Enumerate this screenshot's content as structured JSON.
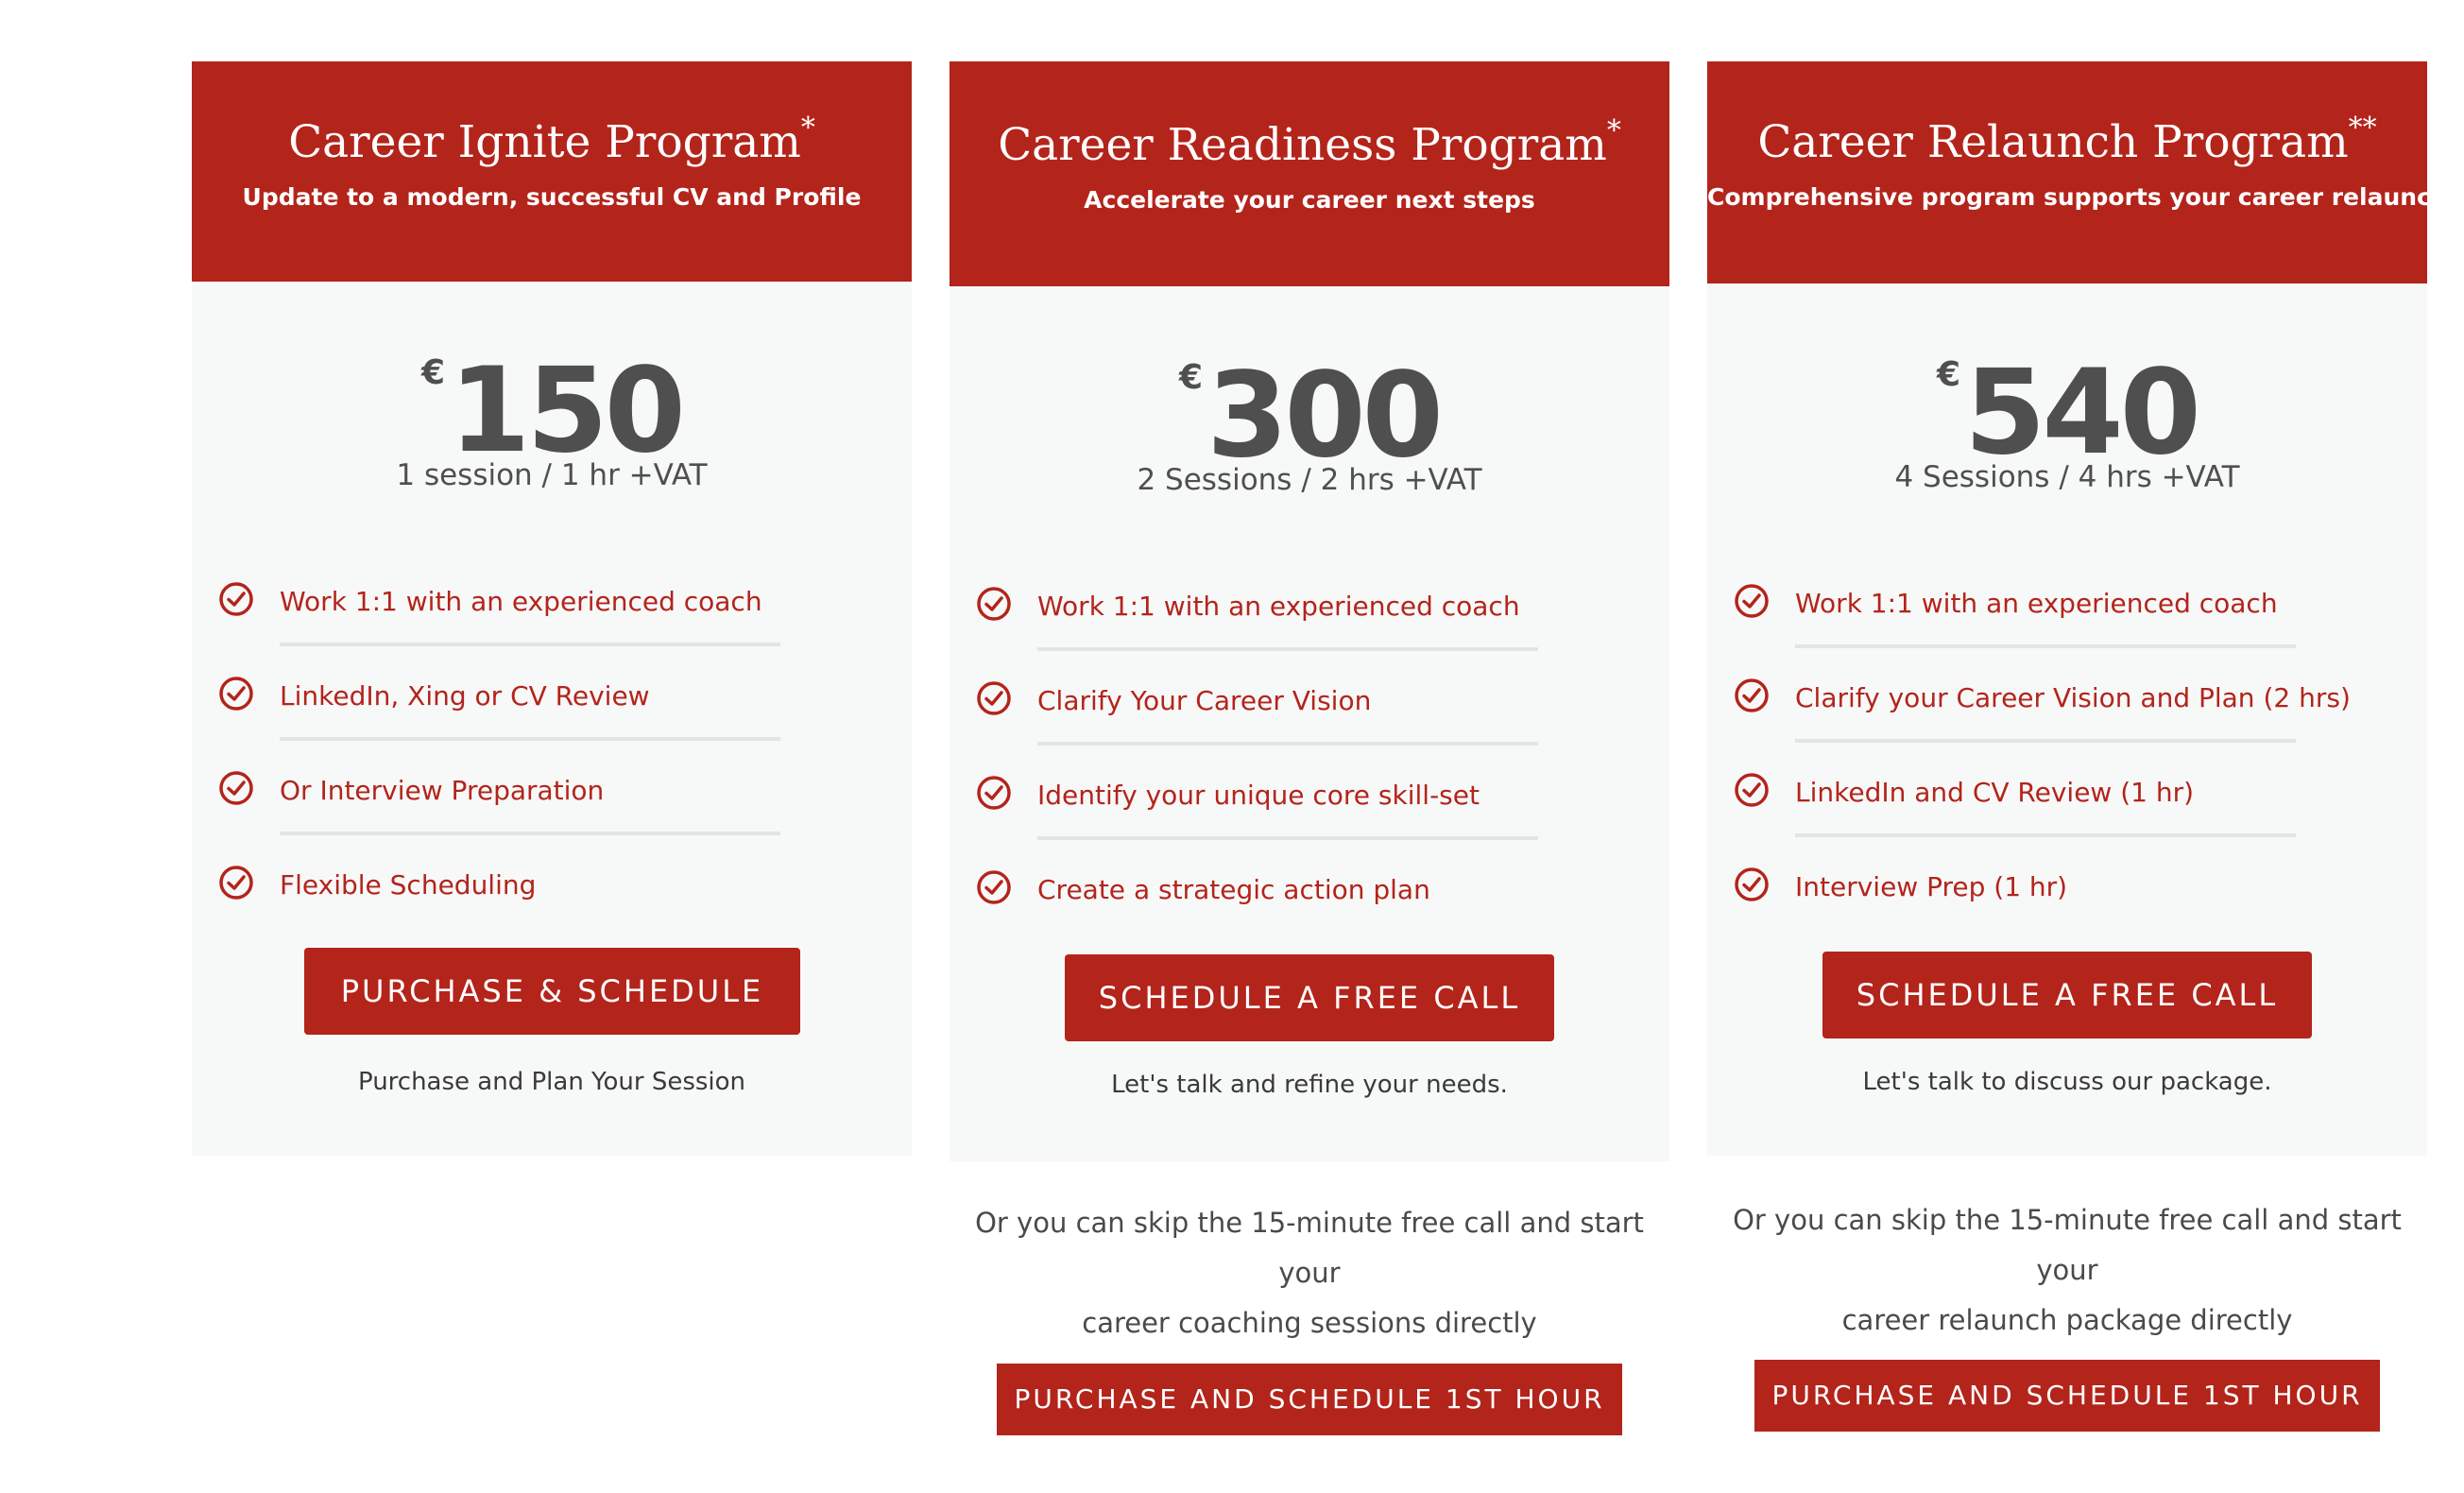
{
  "icons": {
    "feature": "check-circle-icon"
  },
  "colors": {
    "brand_red": "#b3241b",
    "card_bg": "#f7f8f8",
    "price_text": "#4f4f4f"
  },
  "plans": [
    {
      "title": "Career Ignite Program",
      "title_mark": "*",
      "subtitle": "Update to a modern, successful CV and Profile",
      "currency": "€",
      "price": "150",
      "price_detail": "1 session / 1 hr +VAT",
      "features": [
        "Work 1:1 with an experienced coach",
        "LinkedIn, Xing or CV Review",
        "Or Interview Preparation",
        "Flexible Scheduling"
      ],
      "button_label": "PURCHASE & SCHEDULE",
      "button_note": "Purchase and Plan Your Session"
    },
    {
      "title": "Career Readiness Program",
      "title_mark": "*",
      "subtitle": "Accelerate your career next steps",
      "currency": "€",
      "price": "300",
      "price_detail": "2 Sessions / 2 hrs +VAT",
      "features": [
        "Work 1:1 with an experienced coach",
        "Clarify Your Career Vision",
        "Identify your unique core skill-set",
        "Create a strategic action plan"
      ],
      "button_label": "SCHEDULE A FREE CALL",
      "button_note": "Let's talk and refine your needs.",
      "skip_text_line1": "Or you can skip the 15-minute free call and start your",
      "skip_text_line2": "career coaching sessions directly",
      "secondary_button_label": "PURCHASE AND SCHEDULE 1ST HOUR"
    },
    {
      "title": "Career Relaunch Program",
      "title_mark": "**",
      "subtitle": "Comprehensive program supports your career relaunch.",
      "currency": "€",
      "price": "540",
      "price_detail": "4 Sessions / 4 hrs +VAT",
      "features": [
        "Work 1:1 with an experienced coach",
        "Clarify your Career Vision and Plan (2 hrs)",
        "LinkedIn and CV Review (1 hr)",
        "Interview Prep (1 hr)"
      ],
      "button_label": "SCHEDULE A FREE CALL",
      "button_note": "Let's talk to discuss our package.",
      "skip_text_line1": "Or you can skip the 15-minute free call and start your",
      "skip_text_line2": "career relaunch package directly",
      "secondary_button_label": "PURCHASE AND SCHEDULE 1ST HOUR"
    }
  ]
}
